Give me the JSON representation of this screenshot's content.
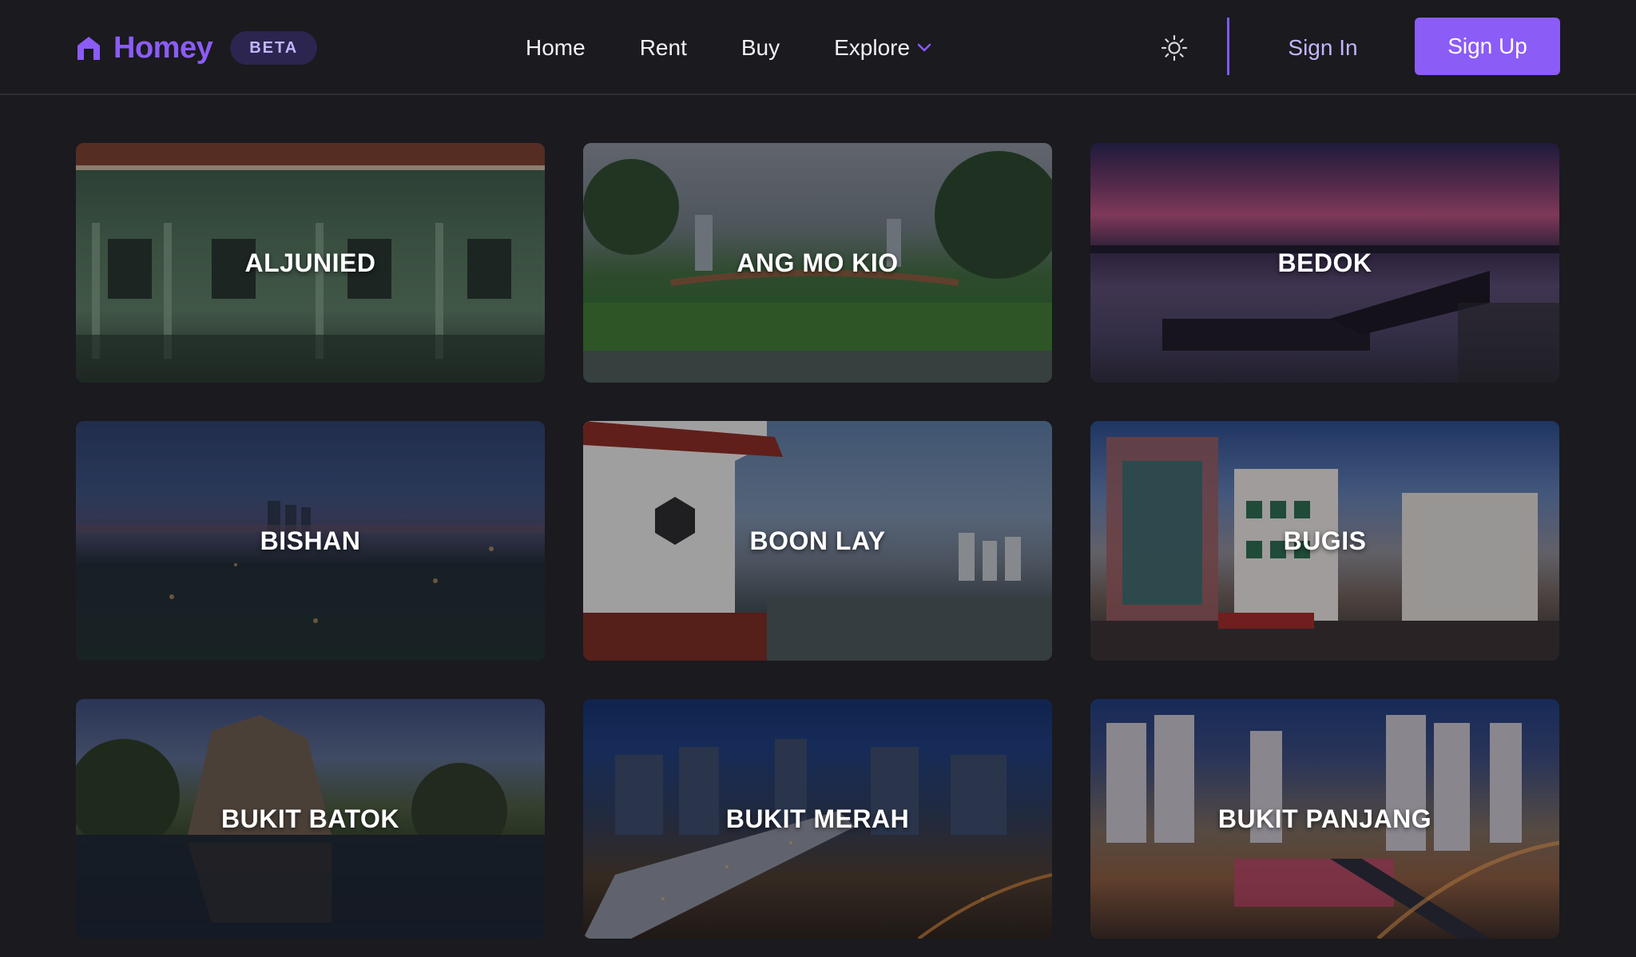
{
  "brand": {
    "name": "Homey",
    "badge": "BETA",
    "accent": "#8b5cf6"
  },
  "nav": {
    "links": [
      {
        "label": "Home"
      },
      {
        "label": "Rent"
      },
      {
        "label": "Buy"
      },
      {
        "label": "Explore",
        "has_dropdown": true
      }
    ],
    "theme_toggle_icon": "sun-icon",
    "sign_in": "Sign In",
    "sign_up": "Sign Up"
  },
  "areas": [
    {
      "name": "ALJUNIED"
    },
    {
      "name": "ANG MO KIO"
    },
    {
      "name": "BEDOK"
    },
    {
      "name": "BISHAN"
    },
    {
      "name": "BOON LAY"
    },
    {
      "name": "BUGIS"
    },
    {
      "name": "BUKIT BATOK"
    },
    {
      "name": "BUKIT MERAH"
    },
    {
      "name": "BUKIT PANJANG"
    }
  ]
}
